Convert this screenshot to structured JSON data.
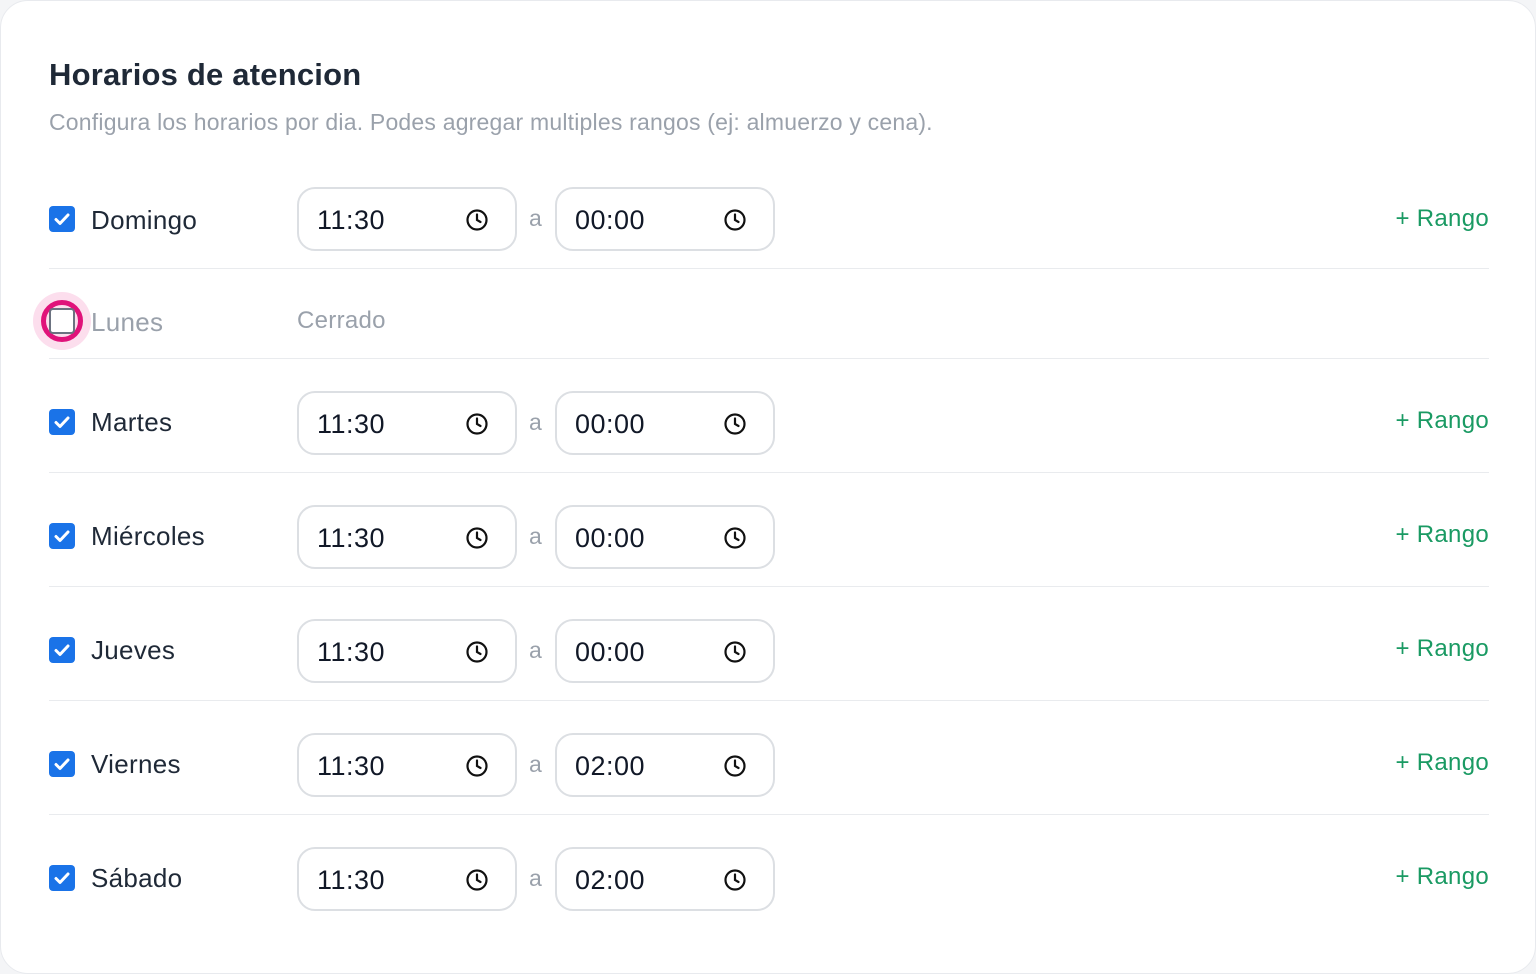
{
  "header": {
    "title": "Horarios de atencion",
    "subtitle": "Configura los horarios por dia. Podes agregar multiples rangos (ej: almuerzo y cena)."
  },
  "labels": {
    "separator": "a",
    "add_range": "+ Rango",
    "closed": "Cerrado"
  },
  "colors": {
    "accent": "#1a73e8",
    "add_range": "#1a9a63",
    "focus": "#e0127a"
  },
  "days": [
    {
      "name": "Domingo",
      "enabled": true,
      "from": "11:30",
      "to": "00:00"
    },
    {
      "name": "Lunes",
      "enabled": false
    },
    {
      "name": "Martes",
      "enabled": true,
      "from": "11:30",
      "to": "00:00"
    },
    {
      "name": "Miércoles",
      "enabled": true,
      "from": "11:30",
      "to": "00:00"
    },
    {
      "name": "Jueves",
      "enabled": true,
      "from": "11:30",
      "to": "00:00"
    },
    {
      "name": "Viernes",
      "enabled": true,
      "from": "11:30",
      "to": "02:00"
    },
    {
      "name": "Sábado",
      "enabled": true,
      "from": "11:30",
      "to": "02:00"
    }
  ]
}
